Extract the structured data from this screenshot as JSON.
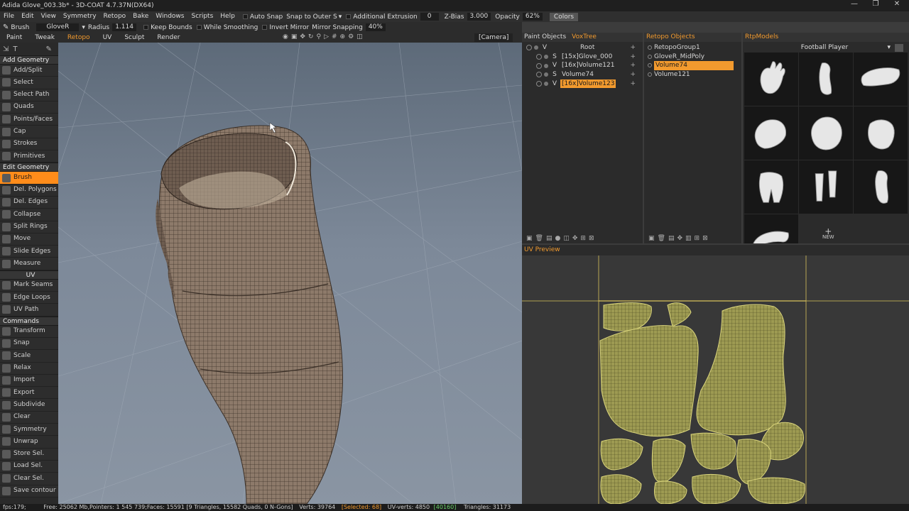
{
  "window": {
    "title": "Adida Glove_003.3b* - 3D-COAT 4.7.37N(DX64)",
    "minimize": "—",
    "maximize": "❐",
    "close": "✕"
  },
  "menu": {
    "items": [
      "File",
      "Edit",
      "View",
      "Symmetry",
      "Retopo",
      "Bake",
      "Windows",
      "Scripts",
      "Help"
    ],
    "auto_snap": "Auto Snap",
    "snap_to": "Snap to Outer S",
    "additional_extrusion": "Additional Extrusion",
    "extrusion_value": "0",
    "zbias_label": "Z-Bias",
    "zbias_value": "3.000",
    "opacity_label": "Opacity",
    "opacity_value": "62%",
    "colors_button": "Colors"
  },
  "toolbar": {
    "brush_label": "Brush",
    "brush_preset": "GloveR",
    "radius_label": "Radius",
    "radius_value": "1.114",
    "keep_bounds": "Keep Bounds",
    "while_smoothing": "While Smoothing",
    "invert_mirror": "Invert Mirror",
    "mirror_snapping": "Mirror Snapping",
    "mirror_snapping_value": "40%"
  },
  "tabs": [
    {
      "label": "Paint",
      "active": false
    },
    {
      "label": "Tweak",
      "active": false
    },
    {
      "label": "Retopo",
      "active": true
    },
    {
      "label": "UV",
      "active": false
    },
    {
      "label": "Sculpt",
      "active": false
    },
    {
      "label": "Render",
      "active": false
    }
  ],
  "camera_label": "[Camera]",
  "sidebar": {
    "add_geometry_header": "Add Geometry",
    "add_tools": [
      "Add/Split",
      "Select",
      "Select Path",
      "Quads",
      "Points/Faces",
      "Cap",
      "Strokes",
      "Primitives"
    ],
    "edit_geometry_header": "Edit Geometry",
    "edit_tools": [
      "Brush",
      "Del. Polygons",
      "Del. Edges",
      "Collapse",
      "Split Rings",
      "Move",
      "Slide Edges",
      "Measure"
    ],
    "active_tool": "Brush",
    "uv_header": "UV",
    "uv_tools": [
      "Mark Seams",
      "Edge Loops",
      "UV Path"
    ],
    "commands_header": "Commands",
    "command_tools": [
      "Transform",
      "Snap",
      "Scale",
      "Relax",
      "Import",
      "Export",
      "Subdivide",
      "Clear",
      "Symmetry",
      "Unwrap",
      "Store Sel.",
      "Load Sel.",
      "Clear Sel.",
      "Save contour"
    ]
  },
  "panels": {
    "left_tabs": [
      "Paint Objects",
      "VoxTree"
    ],
    "left_active": "VoxTree",
    "voxtree": [
      {
        "flag": "V",
        "label": "Root",
        "selected": false,
        "indent": 0
      },
      {
        "flag": "S",
        "label": "[15x]Glove_000",
        "selected": false,
        "indent": 1
      },
      {
        "flag": "V",
        "label": "[16x]Volume121",
        "selected": false,
        "indent": 1
      },
      {
        "flag": "S",
        "label": "Volume74",
        "selected": false,
        "indent": 1
      },
      {
        "flag": "V",
        "label": "[16x]Volume123",
        "selected": true,
        "indent": 1
      }
    ],
    "retopo_title": "Retopo Objects",
    "retopo_objects": [
      {
        "label": "RetopoGroup1",
        "selected": false
      },
      {
        "label": "GloveR_MidPoly",
        "selected": false
      },
      {
        "label": "Volume74",
        "selected": true
      },
      {
        "label": "Volume121",
        "selected": false
      }
    ],
    "rtp_title": "RtpModels",
    "rtp_category": "Football Player",
    "rtp_items": [
      "hand",
      "arm",
      "collar",
      "shoulder-pad",
      "helmet",
      "torso",
      "shorts",
      "legs",
      "leg",
      "band"
    ],
    "new_label": "NEW"
  },
  "uv_preview": {
    "title": "UV Preview"
  },
  "status": {
    "fps": "fps:179;",
    "free": "Free: 25062 Mb,Pointers: 1 545 739;Faces: 15591 [9 Triangles, 15582 Quads, 0 N-Gons]",
    "verts": "Verts: 39764",
    "selected": "[Selected: 68]",
    "uv_verts": "UV-verts: 4850",
    "uv_verts_extra": "[40160]",
    "triangles": "Triangles: 31173"
  },
  "colors": {
    "accent": "#f29a2e",
    "active_tool": "#ff8c1a",
    "mesh": "#8d7a6a",
    "uv_island": "#9d9a52"
  }
}
